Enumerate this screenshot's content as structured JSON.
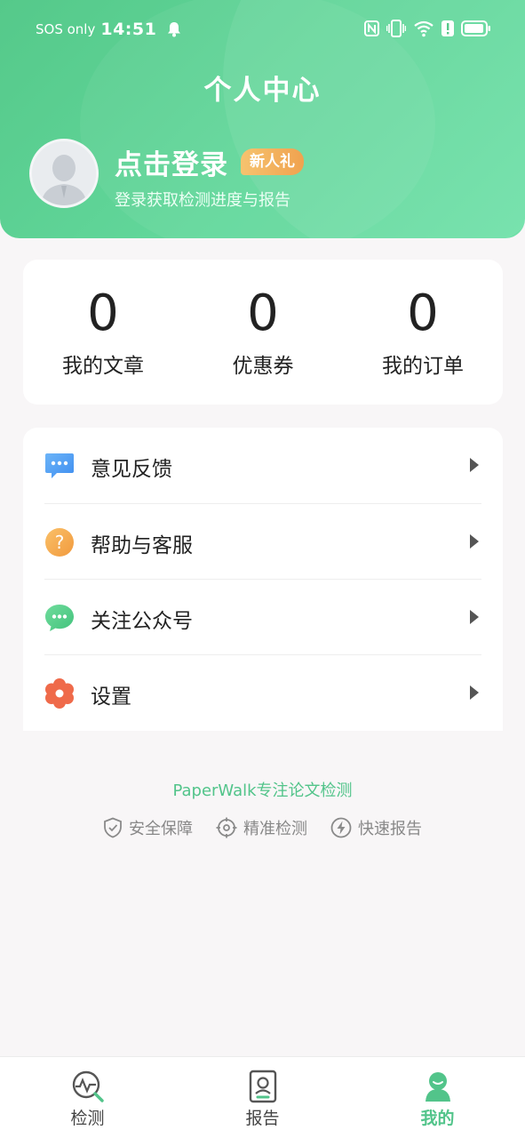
{
  "status_bar": {
    "carrier": "SOS only",
    "time": "14:51",
    "icons": [
      "bell-icon",
      "nfc-icon",
      "vibrate-icon",
      "wifi-icon",
      "alert-icon",
      "battery-icon"
    ]
  },
  "header": {
    "title": "个人中心",
    "login_title": "点击登录",
    "new_badge": "新人礼",
    "login_subtitle": "登录获取检测进度与报告"
  },
  "stats": [
    {
      "value": "0",
      "label": "我的文章"
    },
    {
      "value": "0",
      "label": "优惠券"
    },
    {
      "value": "0",
      "label": "我的订单"
    }
  ],
  "menu": [
    {
      "label": "意见反馈",
      "icon": "feedback-bubble-icon"
    },
    {
      "label": "帮助与客服",
      "icon": "help-question-icon"
    },
    {
      "label": "关注公众号",
      "icon": "wechat-icon"
    },
    {
      "label": "设置",
      "icon": "settings-flower-icon"
    }
  ],
  "footer": {
    "brand_line": "PaperWalk专注论文检测",
    "features": [
      {
        "label": "安全保障",
        "icon": "shield-check-icon"
      },
      {
        "label": "精准检测",
        "icon": "target-icon"
      },
      {
        "label": "快速报告",
        "icon": "lightning-icon"
      }
    ]
  },
  "bottom_nav": [
    {
      "label": "检测",
      "icon": "detect-chart-icon"
    },
    {
      "label": "报告",
      "icon": "report-icon"
    },
    {
      "label": "我的",
      "icon": "profile-icon",
      "active": true
    }
  ],
  "colors": {
    "primary_green": "#52c48a",
    "badge_orange": "#f0a24f",
    "background": "#f8f6f7"
  }
}
